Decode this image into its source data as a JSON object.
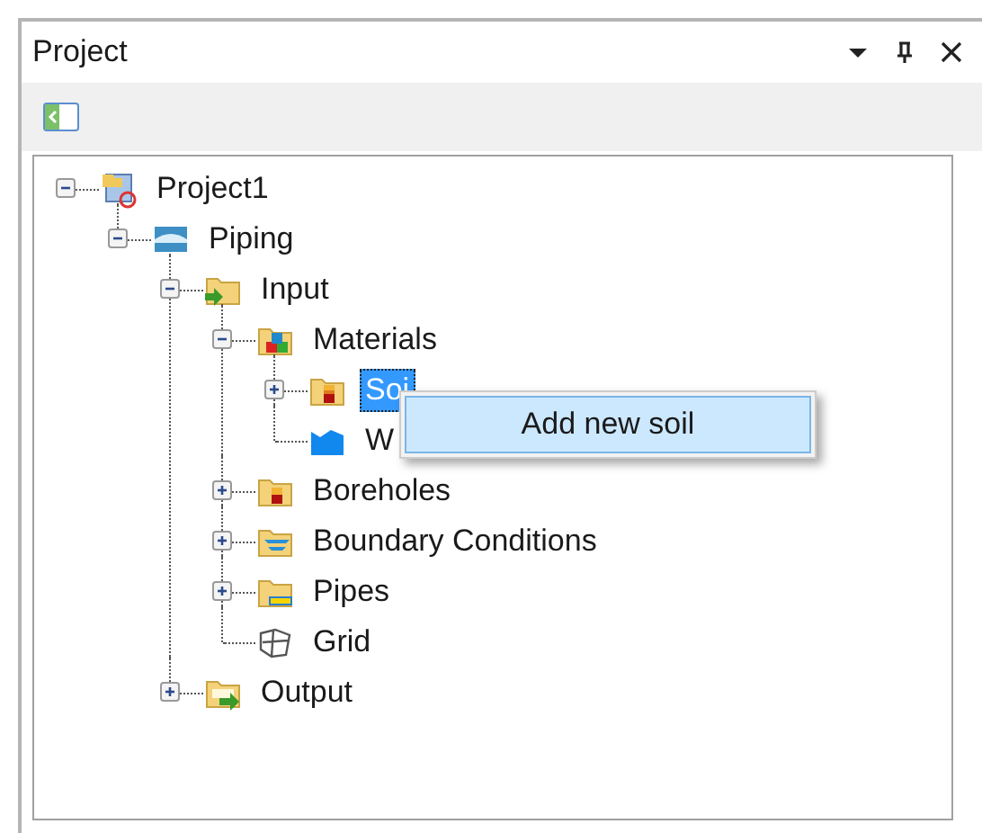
{
  "panel": {
    "title": "Project"
  },
  "tree": [
    {
      "label": "Project1",
      "kind": "project",
      "expanded": true,
      "selected": false,
      "children": [
        {
          "label": "Piping",
          "kind": "piping",
          "expanded": true,
          "selected": false,
          "children": [
            {
              "label": "Input",
              "kind": "input",
              "expanded": true,
              "selected": false,
              "children": [
                {
                  "label": "Materials",
                  "kind": "materials",
                  "expanded": true,
                  "selected": false,
                  "children": [
                    {
                      "label": "Soi",
                      "kind": "soils",
                      "expanded": false,
                      "selected": true
                    },
                    {
                      "label": "W",
                      "kind": "water",
                      "selected": false
                    }
                  ]
                },
                {
                  "label": "Boreholes",
                  "kind": "boreholes",
                  "expanded": false,
                  "selected": false
                },
                {
                  "label": "Boundary Conditions",
                  "kind": "boundary",
                  "expanded": false,
                  "selected": false
                },
                {
                  "label": "Pipes",
                  "kind": "pipes",
                  "expanded": false,
                  "selected": false
                },
                {
                  "label": "Grid",
                  "kind": "grid",
                  "selected": false
                }
              ]
            },
            {
              "label": "Output",
              "kind": "output",
              "expanded": false,
              "selected": false
            }
          ]
        }
      ]
    }
  ],
  "context_menu": {
    "items": [
      {
        "label": "Add new soil",
        "selected": true
      }
    ]
  }
}
